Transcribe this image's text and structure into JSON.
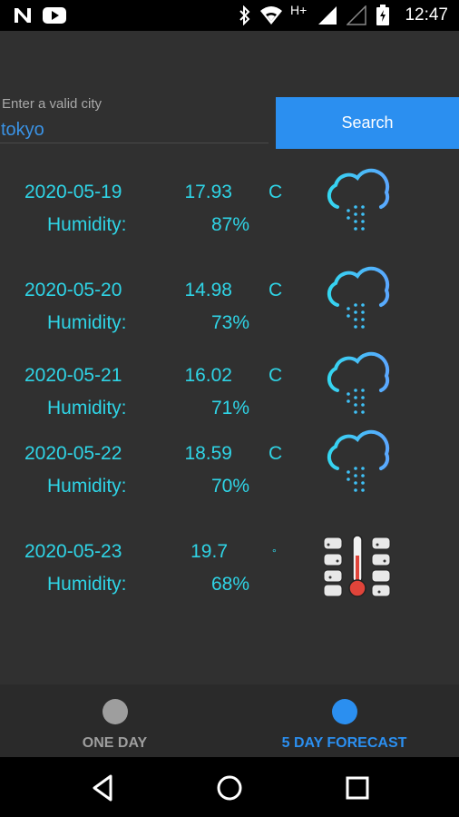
{
  "status_bar": {
    "time": "12:47",
    "network_label": "H+",
    "icons": [
      "n-app-icon",
      "youtube-icon",
      "bluetooth-icon",
      "wifi-icon",
      "signal-icon",
      "battery-icon"
    ]
  },
  "search": {
    "label": "Enter a valid city",
    "value": "tokyo",
    "button_label": "Search"
  },
  "forecast": [
    {
      "date": "2020-05-19",
      "temp": "17.93",
      "unit": "C",
      "humidity_label": "Humidity:",
      "humidity": "87%",
      "icon": "rain-cloud-icon"
    },
    {
      "date": "2020-05-20",
      "temp": "14.98",
      "unit": "C",
      "humidity_label": "Humidity:",
      "humidity": "73%",
      "icon": "rain-cloud-icon"
    },
    {
      "date": "2020-05-21",
      "temp": "16.02",
      "unit": "C",
      "humidity_label": "Humidity:",
      "humidity": "71%",
      "icon": "rain-cloud-icon"
    },
    {
      "date": "2020-05-22",
      "temp": "18.59",
      "unit": "C",
      "humidity_label": "Humidity:",
      "humidity": "70%",
      "icon": "rain-cloud-icon"
    },
    {
      "date": "2020-05-23",
      "temp": "19.7",
      "unit": "°",
      "humidity_label": "Humidity:",
      "humidity": "68%",
      "icon": "thermometer-snow-icon"
    }
  ],
  "bottom_nav": {
    "items": [
      {
        "label": "ONE DAY",
        "active": false
      },
      {
        "label": "5 DAY FORECAST",
        "active": true
      }
    ]
  },
  "colors": {
    "accent_text": "#2fd4e6",
    "button_blue": "#2b8ff0",
    "input_text": "#3a93e6",
    "inactive_nav": "#9e9e9e",
    "active_nav": "#2b8ff0",
    "background": "#303030"
  }
}
